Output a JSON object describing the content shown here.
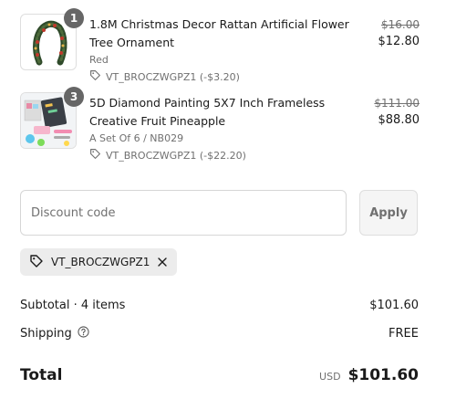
{
  "items": [
    {
      "quantity": "1",
      "title": "1.8M Christmas Decor Rattan Artificial Flower Tree Ornament",
      "variant": "Red",
      "discount": "VT_BROCZWGPZ1 (-$3.20)",
      "original_price": "$16.00",
      "price": "$12.80",
      "image_icon": "christmas-garland-image"
    },
    {
      "quantity": "3",
      "title": "5D Diamond Painting 5X7 Inch Frameless Creative Fruit Pineapple",
      "variant": "A Set Of 6 / NB029",
      "discount": "VT_BROCZWGPZ1 (-$22.20)",
      "original_price": "$111.00",
      "price": "$88.80",
      "image_icon": "diamond-painting-kit-image"
    }
  ],
  "discount_form": {
    "placeholder": "Discount code",
    "value": "",
    "apply_label": "Apply"
  },
  "applied_code": {
    "code": "VT_BROCZWGPZ1"
  },
  "summary": {
    "subtotal_label": "Subtotal · 4 items",
    "subtotal_value": "$101.60",
    "shipping_label": "Shipping",
    "shipping_value": "FREE",
    "total_label": "Total",
    "currency": "USD",
    "total_value": "$101.60"
  },
  "colors": {
    "text": "#1a1a1a",
    "muted": "#707070",
    "badge": "#666666",
    "chip_bg": "#ececec",
    "border": "#d6d6d6"
  }
}
